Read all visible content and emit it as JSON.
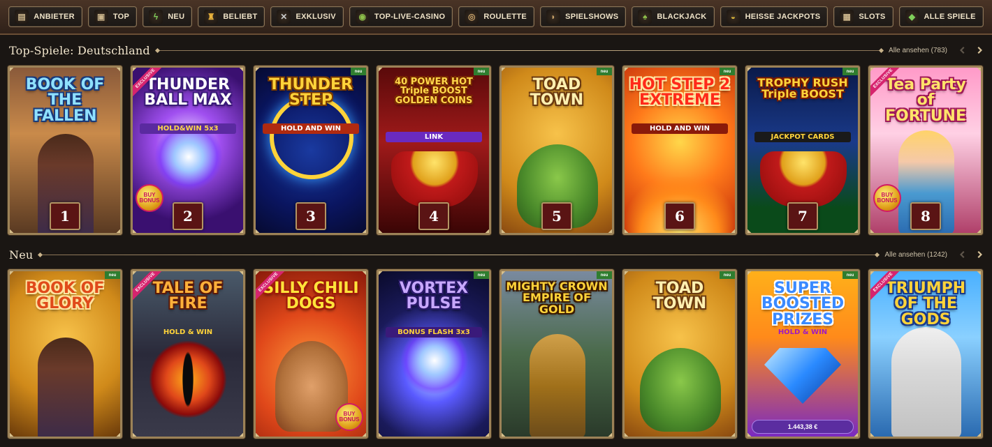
{
  "nav": {
    "items": [
      {
        "label": "ANBIETER",
        "icon": "book-icon",
        "color": "#c9b38a"
      },
      {
        "label": "TOP",
        "icon": "treasure-chest-icon",
        "color": "#c9b38a"
      },
      {
        "label": "NEU",
        "icon": "lightning-icon",
        "color": "#7fcf5a"
      },
      {
        "label": "BELIEBT",
        "icon": "torch-icon",
        "color": "#e9b23c"
      },
      {
        "label": "EXKLUSIV",
        "icon": "crossed-swords-icon",
        "color": "#c9c9c9"
      },
      {
        "label": "TOP-LIVE-CASINO",
        "icon": "coin-icon",
        "color": "#8dbf4a"
      },
      {
        "label": "ROULETTE",
        "icon": "roulette-icon",
        "color": "#c9a36a"
      },
      {
        "label": "SPIELSHOWS",
        "icon": "horn-icon",
        "color": "#c9a36a"
      },
      {
        "label": "BLACKJACK",
        "icon": "card-icon",
        "color": "#8dbf4a"
      },
      {
        "label": "HEISSE JACKPOTS",
        "icon": "pot-icon",
        "color": "#d9b43a"
      },
      {
        "label": "SLOTS",
        "icon": "slot-machine-icon",
        "color": "#c9b38a"
      },
      {
        "label": "ALLE SPIELE",
        "icon": "gem-icon",
        "color": "#7fcf5a"
      }
    ]
  },
  "sections": {
    "top": {
      "title": "Top-Spiele: Deutschland",
      "see_all": "Alle ansehen (783)",
      "games": [
        {
          "title": "BOOK OF THE FALLEN",
          "rank": "1",
          "badge": "",
          "bonus": "",
          "theme": "fallen"
        },
        {
          "title": "THUNDER BALL MAX",
          "sub": "HOLD&WIN 5x3",
          "rank": "2",
          "badge": "EXCLUSIVE",
          "bonus": "BUY BONUS",
          "theme": "thunderball"
        },
        {
          "title": "THUNDER STEP",
          "sub": "HOLD AND WIN",
          "rank": "3",
          "badge": "neu",
          "bonus": "",
          "theme": "thunderstep"
        },
        {
          "title": "40 POWER HOT Triple BOOST GOLDEN COINS",
          "sub": "LINK",
          "rank": "4",
          "badge": "neu",
          "bonus": "",
          "theme": "powerhot"
        },
        {
          "title": "TOAD TOWN",
          "rank": "5",
          "badge": "neu",
          "bonus": "",
          "theme": "toad"
        },
        {
          "title": "HOT STEP 2 EXTREME",
          "sub": "HOLD AND WIN",
          "rank": "6",
          "badge": "neu",
          "bonus": "",
          "theme": "hotstep"
        },
        {
          "title": "TROPHY RUSH Triple BOOST",
          "sub": "JACKPOT CARDS",
          "rank": "7",
          "badge": "neu",
          "bonus": "",
          "theme": "trophy"
        },
        {
          "title": "Tea Party of FORTUNE",
          "rank": "8",
          "badge": "EXCLUSIVE",
          "bonus": "BUY BONUS",
          "theme": "teaparty"
        }
      ]
    },
    "new": {
      "title": "Neu",
      "see_all": "Alle ansehen (1242)",
      "games": [
        {
          "title": "BOOK OF GLORY",
          "badge": "neu",
          "theme": "glory"
        },
        {
          "title": "TALE OF FIRE",
          "sub": "HOLD & WIN",
          "badge": "EXCLUSIVE",
          "theme": "talefire"
        },
        {
          "title": "SILLY CHILI DOGS",
          "badge": "EXCLUSIVE",
          "bonus": "BUY BONUS",
          "theme": "chili"
        },
        {
          "title": "VORTEX PULSE",
          "sub": "BONUS FLASH 3x3",
          "badge": "neu",
          "theme": "vortex"
        },
        {
          "title": "MIGHTY CROWN EMPIRE OF GOLD",
          "badge": "neu",
          "theme": "empire"
        },
        {
          "title": "TOAD TOWN",
          "badge": "neu",
          "theme": "toad"
        },
        {
          "title": "SUPER BOOSTED PRIZES",
          "sub": "HOLD & WIN",
          "badge": "neu",
          "price": "1.443,38 €",
          "theme": "superboosted"
        },
        {
          "title": "TRIUMPH OF THE GODS",
          "badge": "EXCLUSIVE",
          "theme": "triumph"
        }
      ]
    }
  }
}
